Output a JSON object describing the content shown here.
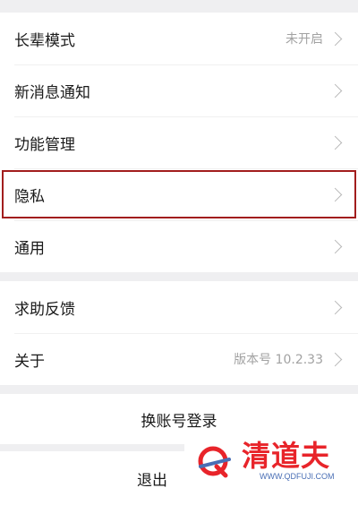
{
  "settings": {
    "items": [
      {
        "label": "长辈模式",
        "value": "未开启"
      },
      {
        "label": "新消息通知",
        "value": ""
      },
      {
        "label": "功能管理",
        "value": ""
      },
      {
        "label": "隐私",
        "value": ""
      },
      {
        "label": "通用",
        "value": ""
      }
    ],
    "items2": [
      {
        "label": "求助反馈",
        "value": ""
      },
      {
        "label": "关于",
        "value": "版本号 10.2.33"
      }
    ]
  },
  "actions": {
    "switch_account": "换账号登录",
    "logout": "退出"
  },
  "watermark": {
    "brand": "清道夫",
    "url": "WWW.QDFUJI.COM"
  },
  "colors": {
    "highlight_box": "#a21d1d",
    "watermark_red": "#e8242a",
    "watermark_blue": "#4a6fb5"
  },
  "icons": {
    "row_arrow": "chevron-right-icon"
  }
}
